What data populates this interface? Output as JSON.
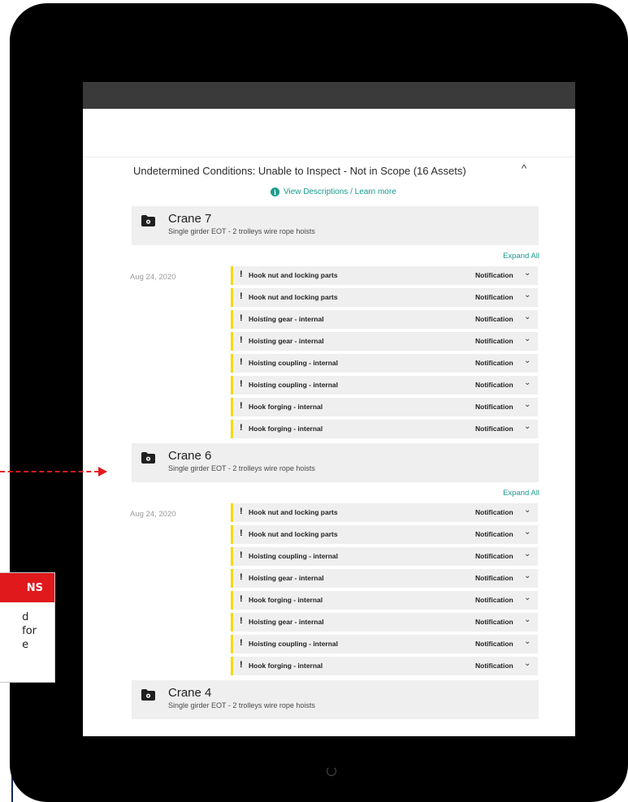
{
  "section": {
    "title": "Undetermined Conditions: Unable to Inspect - Not in Scope (16 Assets)",
    "toggle": "^",
    "learn_more": "View Descriptions / Learn more",
    "info_glyph": "i"
  },
  "expand_all_label": "Expand All",
  "cranes": [
    {
      "title": "Crane 7",
      "subtitle": "Single girder EOT - 2 trolleys wire rope hoists",
      "date": "Aug 24, 2020",
      "items": [
        {
          "name": "Hook nut and locking parts",
          "status": "Notification"
        },
        {
          "name": "Hook nut and locking parts",
          "status": "Notification"
        },
        {
          "name": "Hoisting gear - internal",
          "status": "Notification"
        },
        {
          "name": "Hoisting gear - internal",
          "status": "Notification"
        },
        {
          "name": "Hoisting coupling - internal",
          "status": "Notification"
        },
        {
          "name": "Hoisting coupling - internal",
          "status": "Notification"
        },
        {
          "name": "Hook forging - internal",
          "status": "Notification"
        },
        {
          "name": "Hook forging - internal",
          "status": "Notification"
        }
      ]
    },
    {
      "title": "Crane 6",
      "subtitle": "Single girder EOT - 2 trolleys wire rope hoists",
      "date": "Aug 24, 2020",
      "items": [
        {
          "name": "Hook nut and locking parts",
          "status": "Notification"
        },
        {
          "name": "Hook nut and locking parts",
          "status": "Notification"
        },
        {
          "name": "Hoisting coupling - internal",
          "status": "Notification"
        },
        {
          "name": "Hoisting gear - internal",
          "status": "Notification"
        },
        {
          "name": "Hook forging - internal",
          "status": "Notification"
        },
        {
          "name": "Hoisting gear - internal",
          "status": "Notification"
        },
        {
          "name": "Hoisting coupling - internal",
          "status": "Notification"
        },
        {
          "name": "Hook forging - internal",
          "status": "Notification"
        }
      ]
    },
    {
      "title": "Crane 4",
      "subtitle": "Single girder EOT - 2 trolleys wire rope hoists"
    }
  ],
  "callout": {
    "title": "NS",
    "lines": [
      "d",
      "for",
      "e"
    ]
  },
  "icons": {
    "alert": "!",
    "chevron": "⌄"
  },
  "colors": {
    "accent_teal": "#1a9b8c",
    "alert_yellow": "#f5d90a",
    "annotation_red": "#e0191c"
  }
}
